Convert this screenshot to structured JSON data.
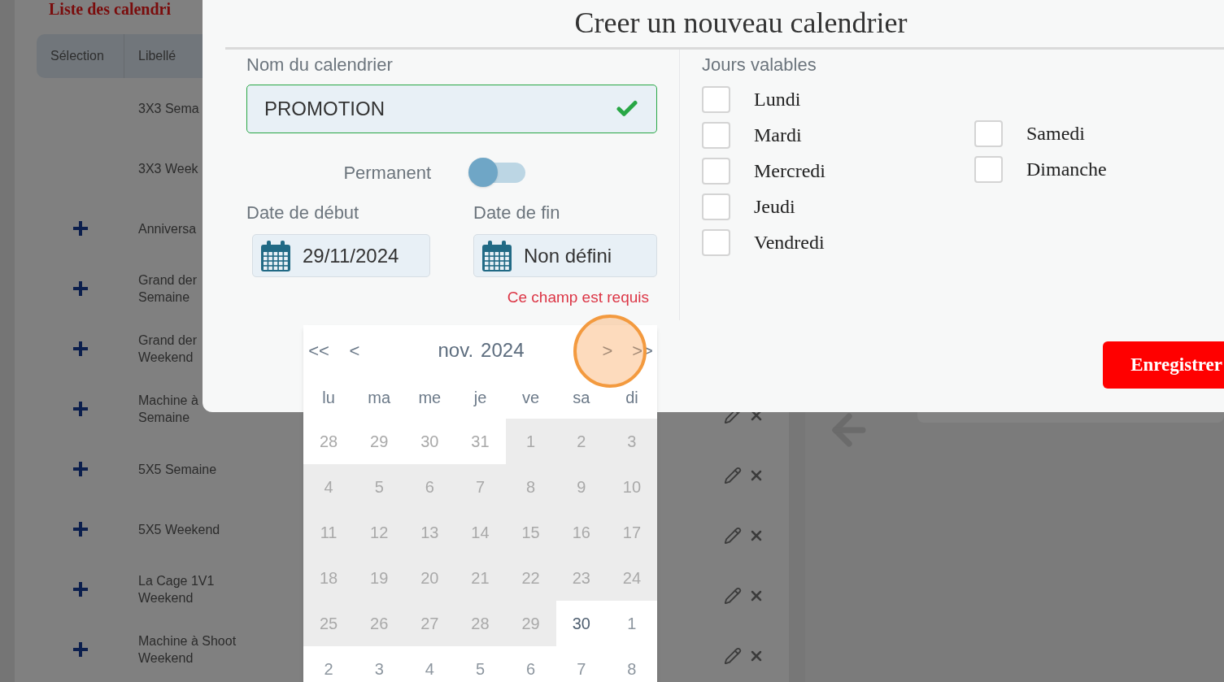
{
  "page": {
    "title": "Liste des calendri",
    "table": {
      "columns": [
        "Sélection",
        "Libellé"
      ],
      "rows": [
        {
          "has_add": false,
          "label_lines": [
            "3X3 Sema"
          ]
        },
        {
          "has_add": false,
          "label_lines": [
            "3X3 Week"
          ]
        },
        {
          "has_add": true,
          "label_lines": [
            "Anniversa"
          ]
        },
        {
          "has_add": true,
          "label_lines": [
            "Grand der",
            "Semaine"
          ]
        },
        {
          "has_add": true,
          "label_lines": [
            "Grand der",
            "Weekend"
          ]
        },
        {
          "has_add": true,
          "label_lines": [
            "Machine à",
            "Semaine"
          ],
          "actions_visible": true
        },
        {
          "has_add": true,
          "label_lines": [
            "5X5 Semaine"
          ],
          "actions_visible": true
        },
        {
          "has_add": true,
          "label_lines": [
            "5X5 Weekend"
          ],
          "actions_visible": true
        },
        {
          "has_add": true,
          "label_lines": [
            "La Cage 1V1",
            "Weekend"
          ],
          "actions_visible": true
        },
        {
          "has_add": true,
          "label_lines": [
            "Machine à Shoot",
            "Weekend"
          ],
          "actions_visible": true
        }
      ]
    }
  },
  "modal": {
    "title": "Creer un nouveau calendrier",
    "name_field": {
      "label": "Nom du calendrier",
      "value": "PROMOTION",
      "valid": true
    },
    "permanent": {
      "label": "Permanent",
      "on": false
    },
    "start_date": {
      "label": "Date de début",
      "value": "29/11/2024"
    },
    "end_date": {
      "label": "Date de fin",
      "value": "Non défini",
      "error": "Ce champ est requis"
    },
    "days_valid": {
      "label": "Jours valables",
      "days": [
        {
          "label": "Lundi",
          "checked": false
        },
        {
          "label": "Mardi",
          "checked": false
        },
        {
          "label": "Mercredi",
          "checked": false
        },
        {
          "label": "Jeudi",
          "checked": false
        },
        {
          "label": "Vendredi",
          "checked": false
        },
        {
          "label": "Samedi",
          "checked": false
        },
        {
          "label": "Dimanche",
          "checked": false
        }
      ]
    },
    "save_button": "Enregistrer"
  },
  "datepicker": {
    "prev_year": "<<",
    "prev_month": "<",
    "month": "nov.",
    "year": "2024",
    "next_month": ">",
    "next_year": ">>",
    "weekdays": [
      "lu",
      "ma",
      "me",
      "je",
      "ve",
      "sa",
      "di"
    ],
    "weeks": [
      [
        {
          "label": "28",
          "disabled": true,
          "outside": true
        },
        {
          "label": "29",
          "disabled": true,
          "outside": true
        },
        {
          "label": "30",
          "disabled": true,
          "outside": true
        },
        {
          "label": "31",
          "disabled": true,
          "outside": true
        },
        {
          "label": "1",
          "disabled": true,
          "outside": false
        },
        {
          "label": "2",
          "disabled": true,
          "outside": false
        },
        {
          "label": "3",
          "disabled": true,
          "outside": false
        }
      ],
      [
        {
          "label": "4",
          "disabled": true,
          "outside": false
        },
        {
          "label": "5",
          "disabled": true,
          "outside": false
        },
        {
          "label": "6",
          "disabled": true,
          "outside": false
        },
        {
          "label": "7",
          "disabled": true,
          "outside": false
        },
        {
          "label": "8",
          "disabled": true,
          "outside": false
        },
        {
          "label": "9",
          "disabled": true,
          "outside": false
        },
        {
          "label": "10",
          "disabled": true,
          "outside": false
        }
      ],
      [
        {
          "label": "11",
          "disabled": true,
          "outside": false
        },
        {
          "label": "12",
          "disabled": true,
          "outside": false
        },
        {
          "label": "13",
          "disabled": true,
          "outside": false
        },
        {
          "label": "14",
          "disabled": true,
          "outside": false
        },
        {
          "label": "15",
          "disabled": true,
          "outside": false
        },
        {
          "label": "16",
          "disabled": true,
          "outside": false
        },
        {
          "label": "17",
          "disabled": true,
          "outside": false
        }
      ],
      [
        {
          "label": "18",
          "disabled": true,
          "outside": false
        },
        {
          "label": "19",
          "disabled": true,
          "outside": false
        },
        {
          "label": "20",
          "disabled": true,
          "outside": false
        },
        {
          "label": "21",
          "disabled": true,
          "outside": false
        },
        {
          "label": "22",
          "disabled": true,
          "outside": false
        },
        {
          "label": "23",
          "disabled": true,
          "outside": false
        },
        {
          "label": "24",
          "disabled": true,
          "outside": false
        }
      ],
      [
        {
          "label": "25",
          "disabled": true,
          "outside": false
        },
        {
          "label": "26",
          "disabled": true,
          "outside": false
        },
        {
          "label": "27",
          "disabled": true,
          "outside": false
        },
        {
          "label": "28",
          "disabled": true,
          "outside": false
        },
        {
          "label": "29",
          "disabled": true,
          "outside": false
        },
        {
          "label": "30",
          "disabled": false,
          "outside": false
        },
        {
          "label": "1",
          "disabled": false,
          "outside": true
        }
      ],
      [
        {
          "label": "2",
          "disabled": false,
          "outside": true
        },
        {
          "label": "3",
          "disabled": false,
          "outside": true
        },
        {
          "label": "4",
          "disabled": false,
          "outside": true
        },
        {
          "label": "5",
          "disabled": false,
          "outside": true
        },
        {
          "label": "6",
          "disabled": false,
          "outside": true
        },
        {
          "label": "7",
          "disabled": false,
          "outside": true
        },
        {
          "label": "8",
          "disabled": false,
          "outside": true
        }
      ]
    ]
  }
}
